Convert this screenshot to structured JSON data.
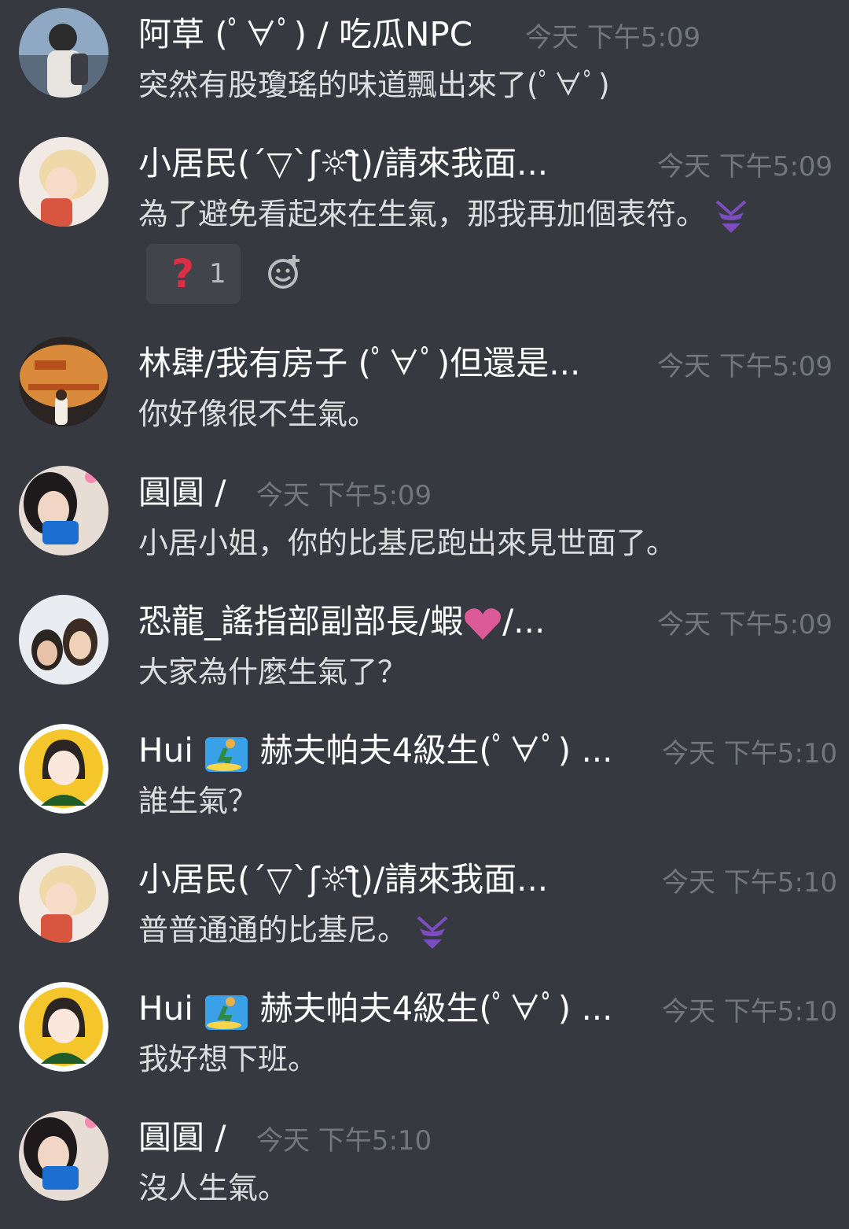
{
  "messages": [
    {
      "author": "阿草 (ﾟ∀ﾟ) / 吃瓜NPC",
      "time": "今天 下午5:09",
      "text": "突然有股瓊瑤的味道飄出來了(ﾟ∀ﾟ)",
      "avatar": "avatar-photo-person-backpack"
    },
    {
      "author": "小居民(´▽`ʃ☼ƪ)/請來我面...",
      "time": "今天 下午5:09",
      "text": "為了避免看起來在生氣，那我再加個表符。",
      "emoji": "bikini-emoji",
      "avatar": "avatar-photo-blonde-girl",
      "reaction": {
        "emoji": "question-mark-emoji",
        "count": "1"
      }
    },
    {
      "author": "林肆/我有房子 (ﾟ∀ﾟ)但還是...",
      "time": "今天 下午5:09",
      "text": "你好像很不生氣。",
      "avatar": "avatar-photo-terminator-wall"
    },
    {
      "author": "圓圓 /",
      "time": "今天 下午5:09",
      "text": "小居小姐，你的比基尼跑出來見世面了。",
      "avatar": "avatar-photo-girl-phone"
    },
    {
      "author": "恐龍_謠指部副部長/蝦",
      "author_suffix": "/...",
      "time": "今天 下午5:09",
      "text": "大家為什麼生氣了？",
      "avatar": "avatar-photo-two-women"
    },
    {
      "author": "Hui",
      "author_suffix": "赫夫帕夫4級生(ﾟ∀ﾟ) ...",
      "time": "今天 下午5:10",
      "text": "誰生氣？",
      "avatar": "avatar-cartoon-girl"
    },
    {
      "author": "小居民(´▽`ʃ☼ƪ)/請來我面...",
      "time": "今天 下午5:10",
      "text": "普普通通的比基尼。",
      "emoji": "bikini-emoji",
      "avatar": "avatar-photo-blonde-girl"
    },
    {
      "author": "Hui",
      "author_suffix": "赫夫帕夫4級生(ﾟ∀ﾟ) ...",
      "time": "今天 下午5:10",
      "text": "我好想下班。",
      "avatar": "avatar-cartoon-girl"
    },
    {
      "author": "圓圓 /",
      "time": "今天 下午5:10",
      "text": "沒人生氣。",
      "avatar": "avatar-photo-girl-phone"
    }
  ],
  "colors": {
    "background": "#36393f",
    "author": "#ffffff",
    "timestamp": "#72767d",
    "text": "#dcddde",
    "reaction_bg": "#41444b"
  }
}
